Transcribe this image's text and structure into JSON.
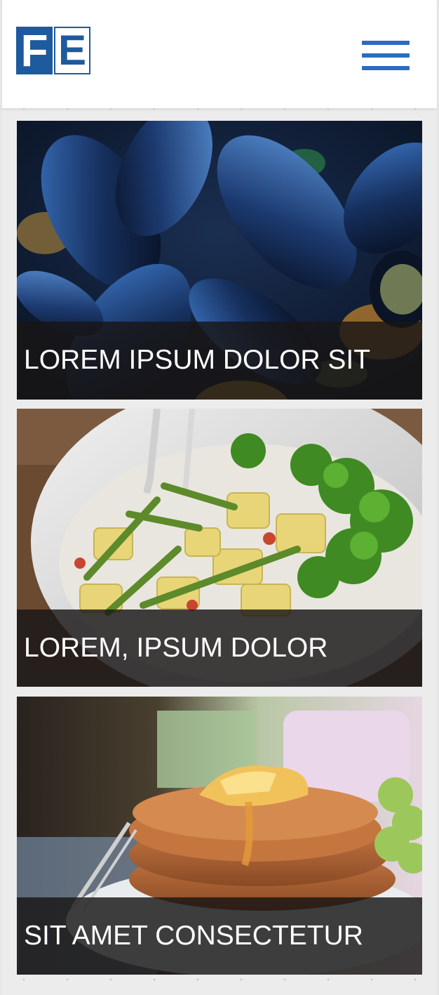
{
  "header": {
    "logo_letters": [
      "F",
      "E"
    ],
    "menu_icon": "hamburger-menu-icon",
    "brand_color": "#1e5a9e",
    "menu_color": "#2b6cc0"
  },
  "cards": [
    {
      "title": "LOREM IPSUM DOLOR SIT",
      "image": "mussels-photo"
    },
    {
      "title": "LOREM, IPSUM DOLOR",
      "image": "potato-salad-photo"
    },
    {
      "title": "SIT AMET CONSECTETUR",
      "image": "pancakes-photo"
    }
  ]
}
